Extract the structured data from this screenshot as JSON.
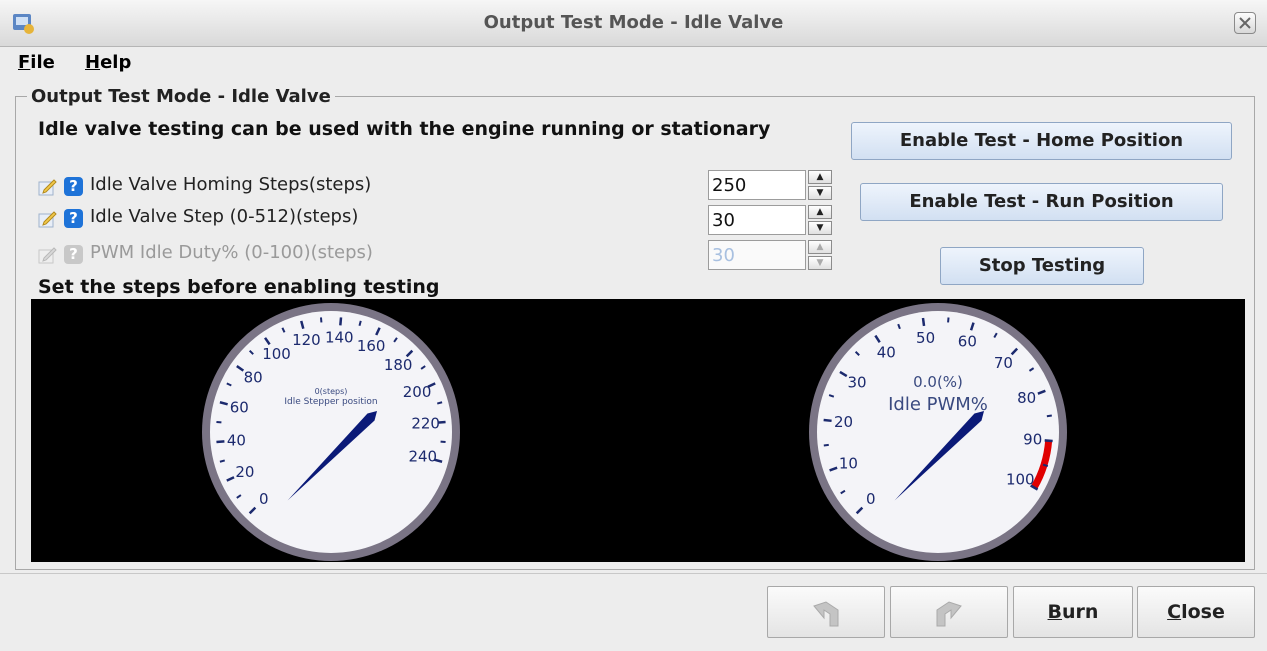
{
  "window": {
    "title": "Output Test Mode - Idle Valve"
  },
  "menu": [
    {
      "label": "File",
      "mnemonic": "F",
      "rest": "ile"
    },
    {
      "label": "Help",
      "mnemonic": "H",
      "rest": "elp"
    }
  ],
  "panel": {
    "title": "Output Test Mode - Idle Valve",
    "info": "Idle valve testing can be used with the engine running or stationary",
    "note": "Set the steps before enabling testing"
  },
  "params": [
    {
      "label": "Idle Valve Homing Steps(steps)",
      "value": "250",
      "enabled": true
    },
    {
      "label": "Idle Valve Step (0-512)(steps)",
      "value": "30",
      "enabled": true
    },
    {
      "label": "PWM Idle Duty% (0-100)(steps)",
      "value": "30",
      "enabled": false
    }
  ],
  "buttons": {
    "home": "Enable Test - Home Position",
    "run": "Enable Test - Run Position",
    "stop": "Stop Testing"
  },
  "gauges": [
    {
      "title": "Idle Stepper position",
      "readout": "0(steps)",
      "min": 0,
      "max": 250,
      "value": 0,
      "tick_labels": [
        "0",
        "20",
        "40",
        "60",
        "80",
        "100",
        "120",
        "140",
        "160",
        "180",
        "200",
        "220",
        "240"
      ]
    },
    {
      "title": "Idle PWM%",
      "readout": "0.0(%)",
      "min": 0,
      "max": 100,
      "value": 0,
      "warning_from": 90,
      "tick_labels": [
        "0",
        "10",
        "20",
        "30",
        "40",
        "50",
        "60",
        "70",
        "80",
        "90",
        "100"
      ]
    }
  ],
  "footer": {
    "undo_icon": "undo-arrow-icon",
    "redo_icon": "redo-arrow-icon",
    "burn": {
      "mnemonic": "B",
      "rest": "urn"
    },
    "close": {
      "mnemonic": "C",
      "rest": "lose"
    }
  },
  "colors": {
    "needle": "#0b1a78",
    "dial_text": "#1c2a6e",
    "warning_arc": "#e00000",
    "button_face": "#d9e5f5"
  }
}
